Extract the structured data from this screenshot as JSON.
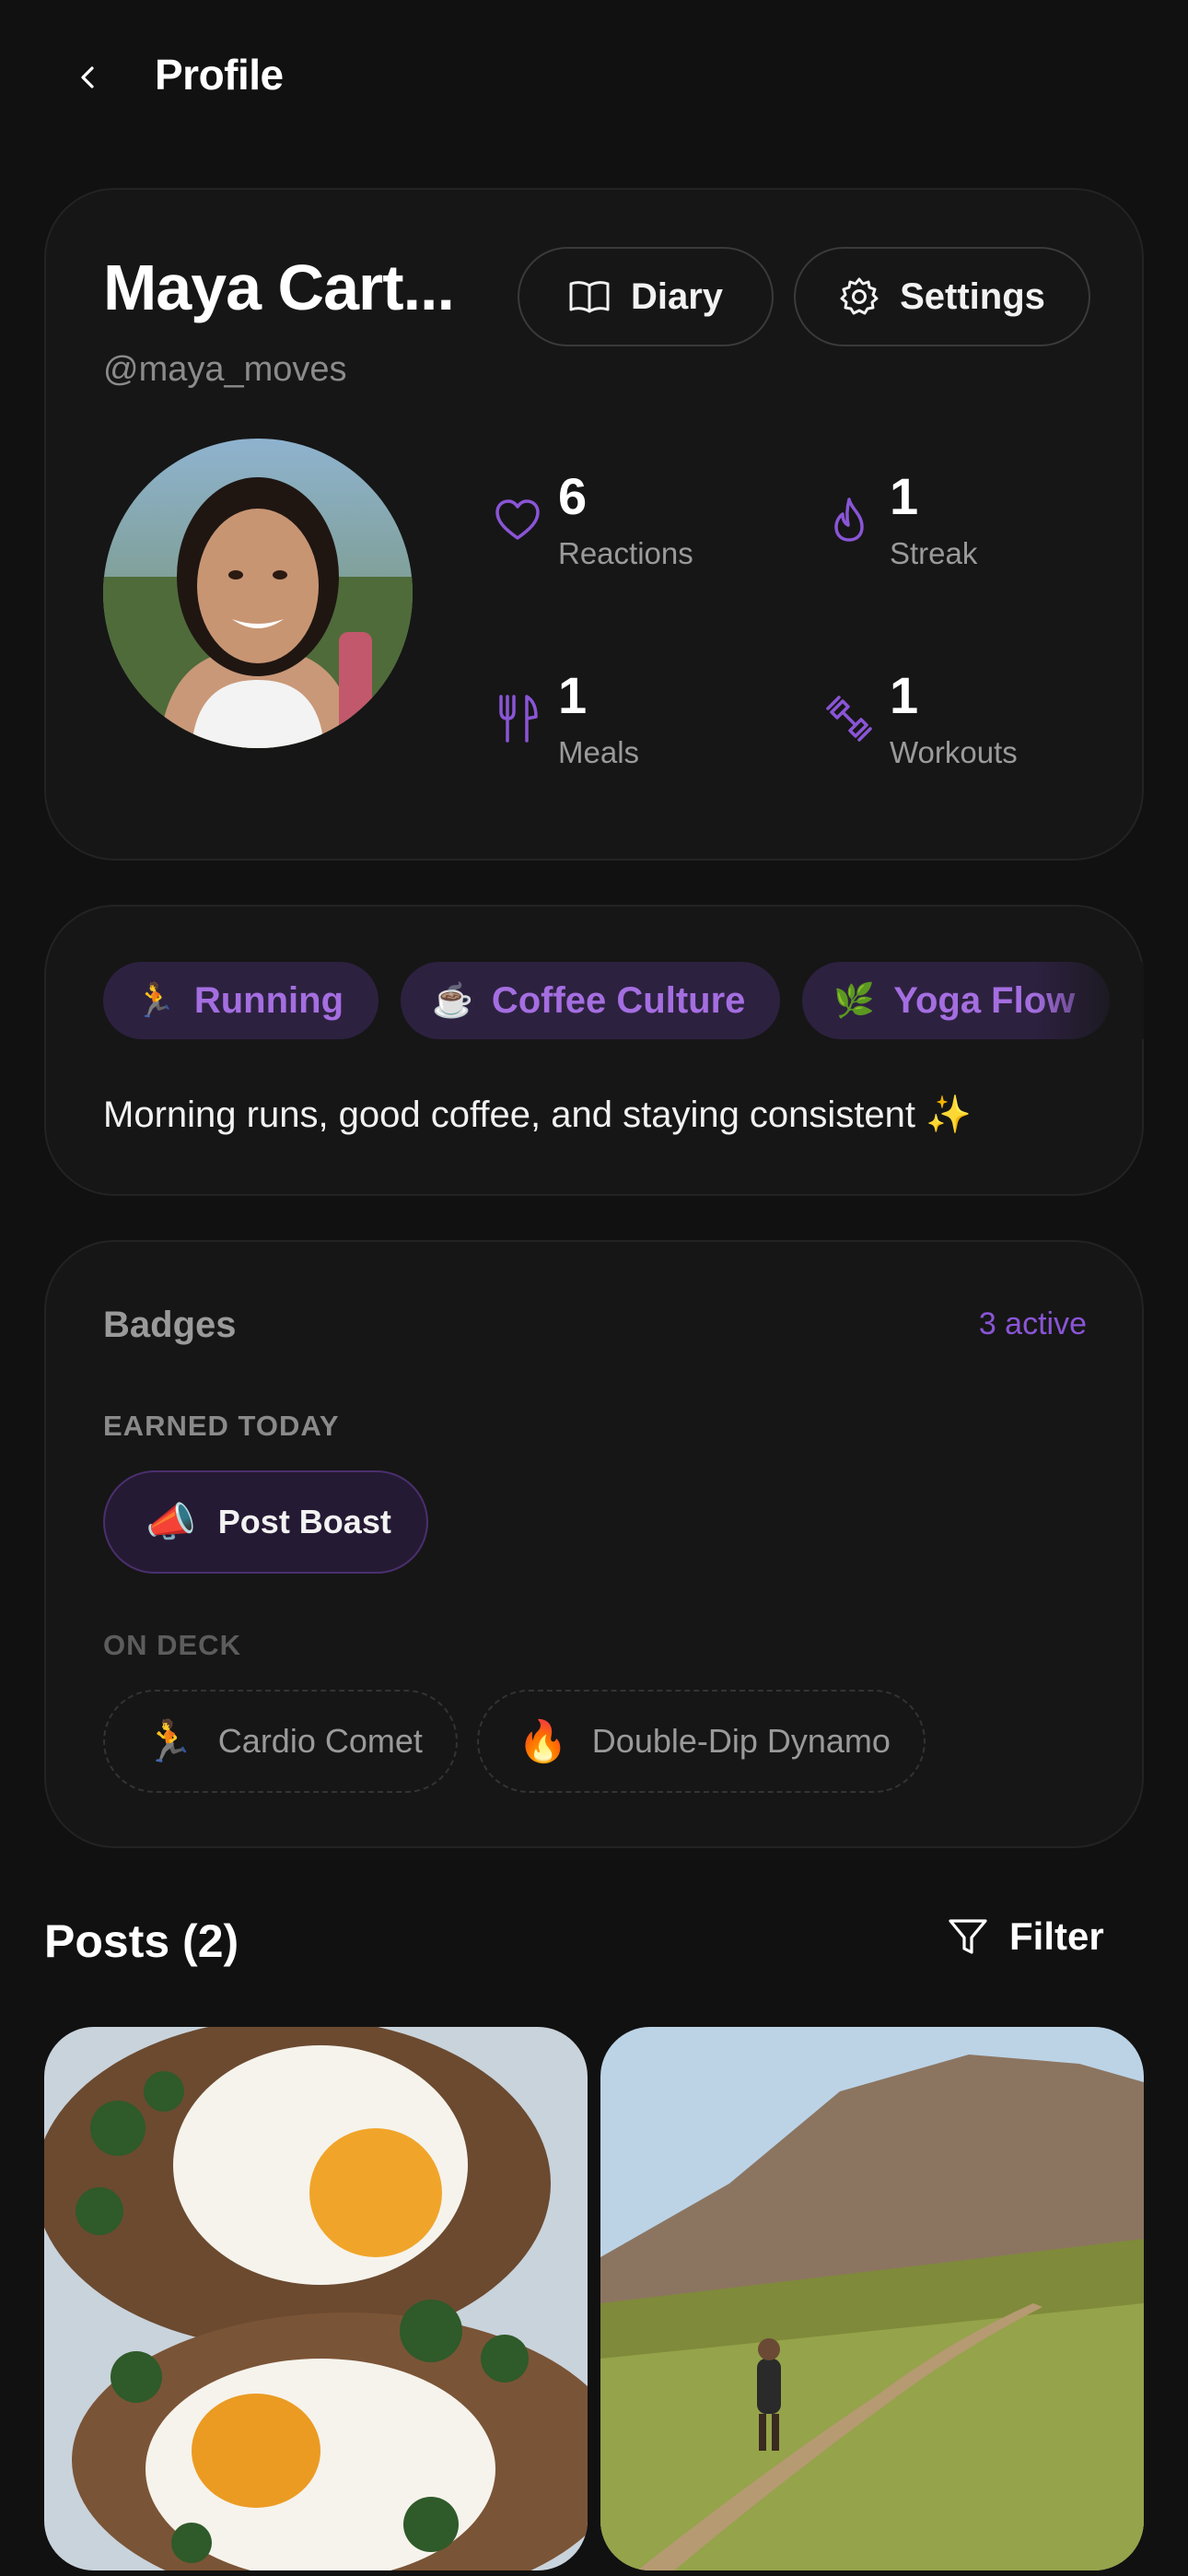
{
  "header": {
    "title": "Profile",
    "back_icon": "chevron-left-icon"
  },
  "profile": {
    "name": "Maya Cart...",
    "handle": "@maya_moves",
    "diary_label": "Diary",
    "settings_label": "Settings",
    "stats": [
      {
        "icon": "heart-icon",
        "value": "6",
        "label": "Reactions"
      },
      {
        "icon": "flame-icon",
        "value": "1",
        "label": "Streak"
      },
      {
        "icon": "utensils-icon",
        "value": "1",
        "label": "Meals"
      },
      {
        "icon": "dumbbell-icon",
        "value": "1",
        "label": "Workouts"
      }
    ]
  },
  "interests": {
    "tags": [
      {
        "emoji": "🏃",
        "label": "Running"
      },
      {
        "emoji": "☕",
        "label": "Coffee Culture"
      },
      {
        "emoji": "🌿",
        "label": "Yoga Flow"
      }
    ],
    "bio": "Morning runs, good coffee, and staying consistent ✨"
  },
  "badges": {
    "title": "Badges",
    "count": "3 active",
    "earned_label": "EARNED TODAY",
    "earned": [
      {
        "emoji": "📣",
        "label": "Post Boast"
      }
    ],
    "deck_label": "ON DECK",
    "on_deck": [
      {
        "emoji": "🏃",
        "label": "Cardio Comet"
      },
      {
        "emoji": "🔥",
        "label": "Double-Dip Dynamo"
      }
    ]
  },
  "posts": {
    "title": "Posts (2)",
    "filter_label": "Filter"
  },
  "colors": {
    "background": "#111111",
    "card": "#161616",
    "accent": "#8a55d6",
    "tag_bg": "#2d2140"
  }
}
